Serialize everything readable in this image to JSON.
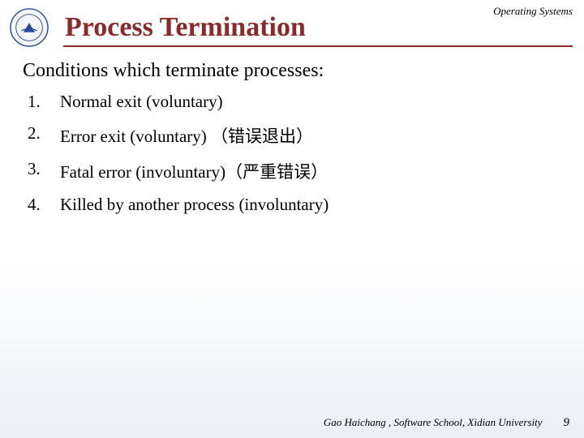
{
  "header": {
    "course_label": "Operating Systems",
    "title": "Process Termination"
  },
  "content": {
    "subhead": "Conditions which terminate processes:",
    "items": [
      {
        "num": "1.",
        "text": "Normal exit (voluntary)"
      },
      {
        "num": "2.",
        "text": "Error exit (voluntary) （错误退出）"
      },
      {
        "num": "3.",
        "text": "Fatal error (involuntary)（严重错误）"
      },
      {
        "num": "4.",
        "text": "Killed by another process (involuntary)"
      }
    ]
  },
  "footer": {
    "credit": "Gao Haichang , Software School, Xidian University",
    "page": "9"
  }
}
